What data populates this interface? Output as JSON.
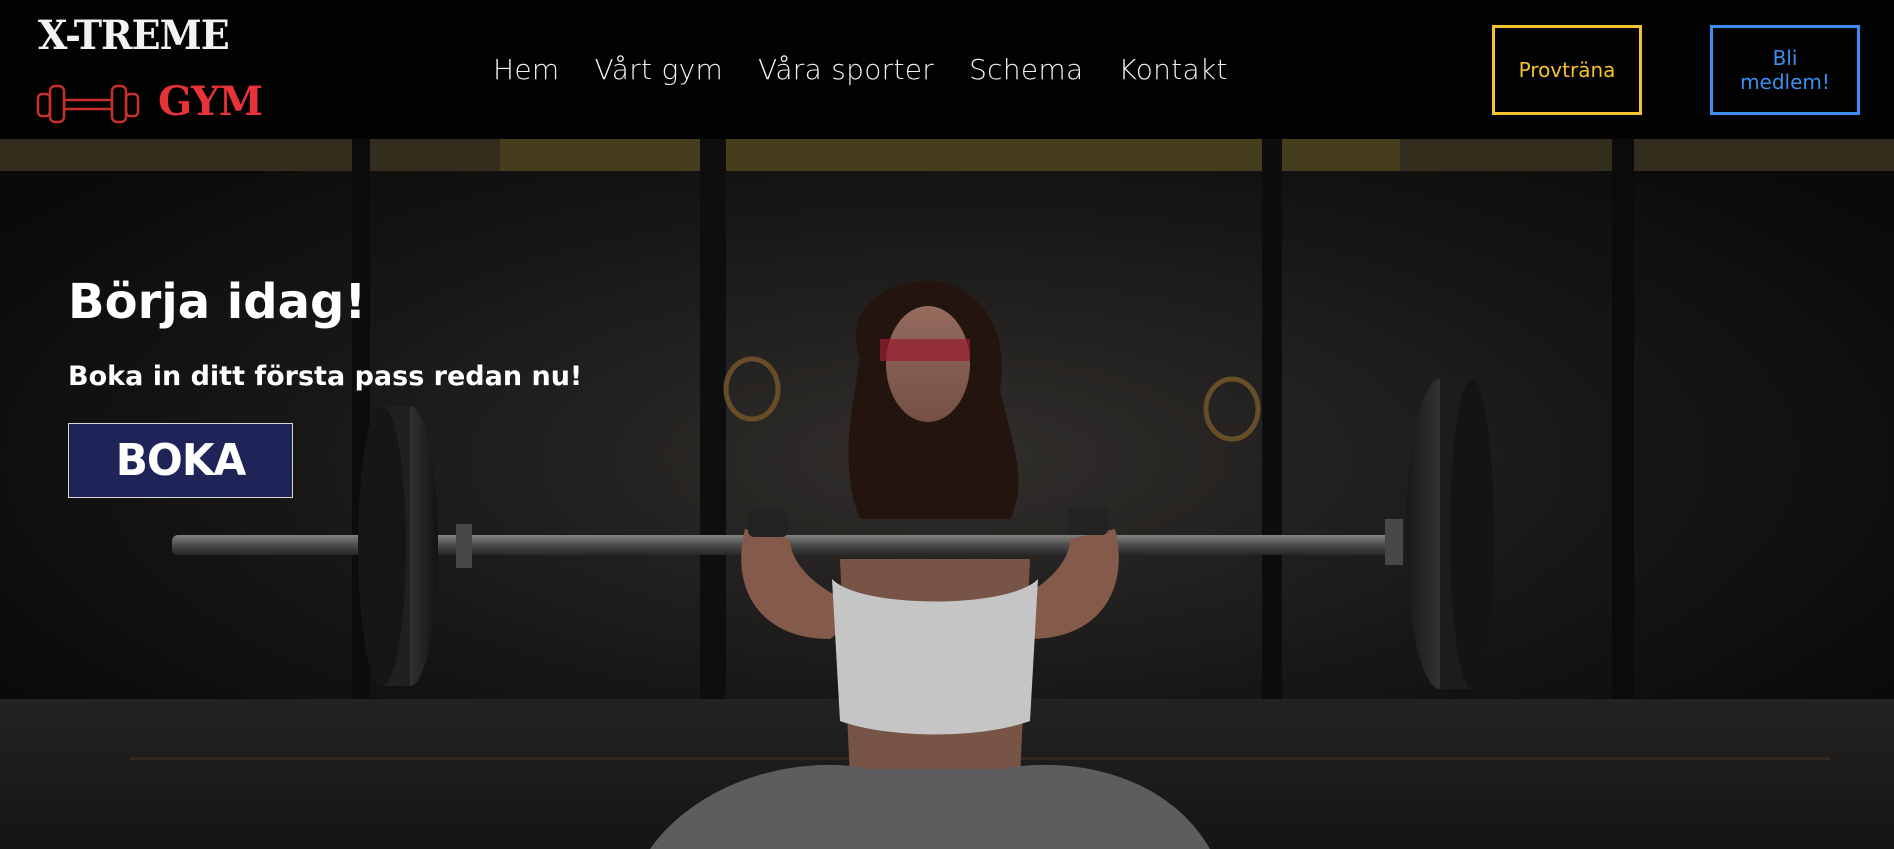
{
  "brand": {
    "line1": "X-TREME",
    "line2": "GYM",
    "accent_red": "#e8323a"
  },
  "nav": {
    "items": [
      {
        "label": "Hem"
      },
      {
        "label": "Vårt gym"
      },
      {
        "label": "Våra sporter"
      },
      {
        "label": "Schema"
      },
      {
        "label": "Kontakt"
      }
    ]
  },
  "header_buttons": {
    "trial_label": "Provträna",
    "trial_color": "#f2c230",
    "member_label": "Bli medlem!",
    "member_color": "#3c8ff0"
  },
  "hero": {
    "title": "Börja idag!",
    "subtitle": "Boka in ditt första pass redan nu!",
    "cta_label": "BOKA",
    "cta_color": "#1f2458"
  },
  "icons": {
    "logo_dumbbell": "dumbbell-icon"
  }
}
